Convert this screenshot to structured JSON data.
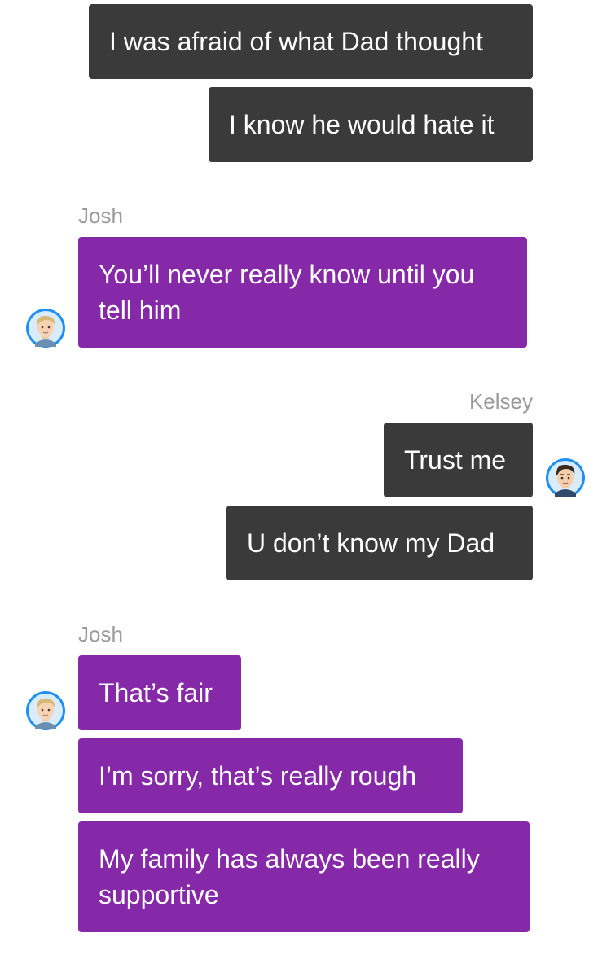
{
  "conversation": {
    "group1": {
      "messages": [
        "I was afraid of what Dad thought",
        "I know he would hate it"
      ]
    },
    "group2": {
      "sender": "Josh",
      "avatar_icon": "josh-avatar-icon",
      "messages": [
        "You’ll never really know until you tell him"
      ]
    },
    "group3": {
      "sender": "Kelsey",
      "avatar_icon": "kelsey-avatar-icon",
      "messages": [
        "Trust me",
        "U don’t know my Dad"
      ]
    },
    "group4": {
      "sender": "Josh",
      "avatar_icon": "josh-avatar-icon",
      "messages": [
        "That’s fair",
        "I’m sorry, that’s really rough",
        "My family has always been really supportive"
      ]
    }
  },
  "colors": {
    "outgoing_bubble": "#3a3a3a",
    "incoming_bubble": "#8629a9",
    "sender_label": "#9a9a9a",
    "avatar_ring": "#1f8ff0"
  }
}
